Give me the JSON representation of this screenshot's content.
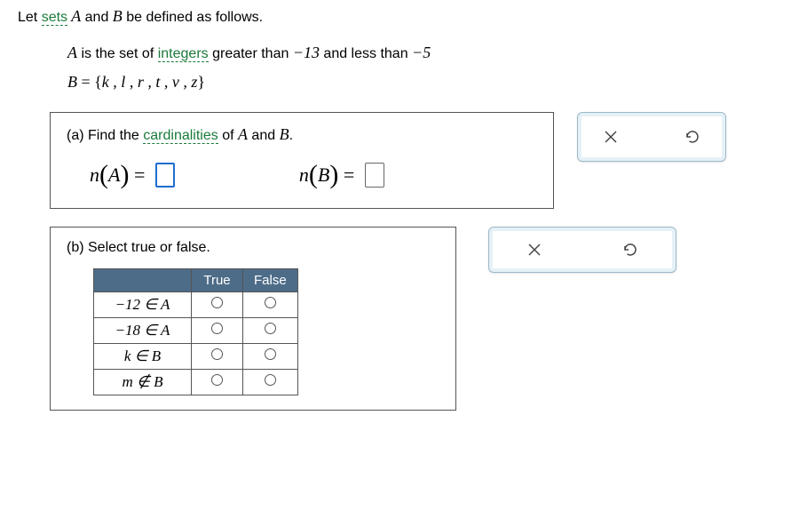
{
  "intro": {
    "prefix": "Let ",
    "sets_link": "sets",
    "after": " A and B be defined as follows."
  },
  "def": {
    "line1_pre": "A",
    "line1_mid": " is the set of ",
    "integers_link": "integers",
    "line1_post1": " greater than ",
    "neg13": "−13",
    "line1_post2": " and less than ",
    "neg5": "−5",
    "line2": "B = {k , l , r , t , v , z}"
  },
  "part_a": {
    "label": "(a)",
    "text_pre": " Find the ",
    "card_link": "cardinalities",
    "text_post": " of A and B.",
    "nA": "n",
    "A": "A",
    "nB": "n",
    "B": "B",
    "eq": "="
  },
  "part_b": {
    "label": "(b)",
    "text": " Select true or false.",
    "headers": {
      "true": "True",
      "false": "False"
    },
    "rows": [
      {
        "expr": "−12 ∈ A"
      },
      {
        "expr": "−18 ∈ A"
      },
      {
        "expr": "k ∈ B"
      },
      {
        "expr": "m ∉ B"
      }
    ]
  },
  "icons": {
    "close": "close-icon",
    "undo": "undo-icon"
  }
}
